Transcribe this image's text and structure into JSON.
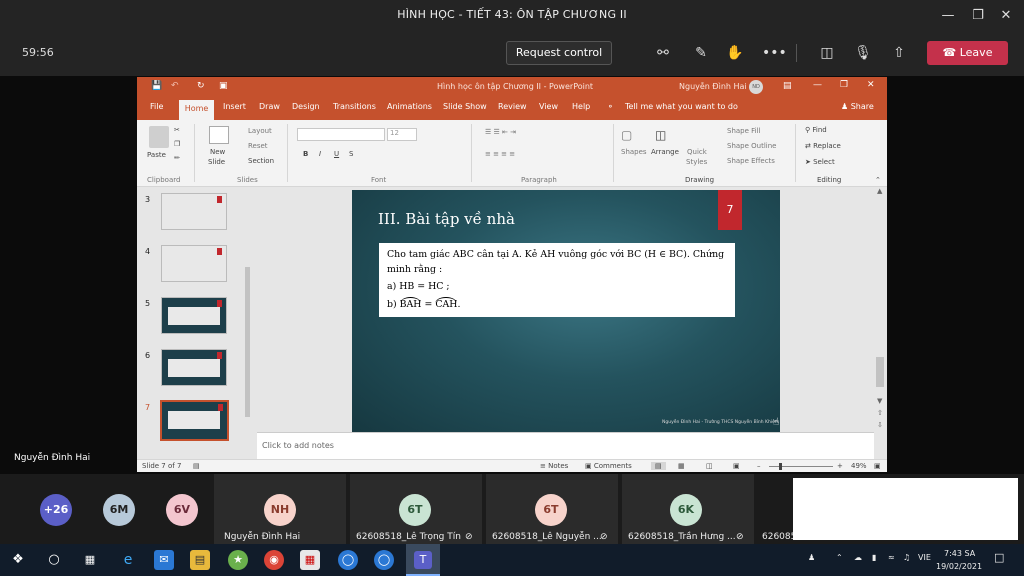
{
  "window": {
    "title": "HÌNH HỌC - TIẾT 43: ÔN TẬP CHƯƠNG II"
  },
  "meeting": {
    "timer": "59:56",
    "request_control": "Request control",
    "leave": "Leave",
    "icons": [
      "people-icon",
      "chat-icon",
      "raise-hand-icon",
      "more-icon",
      "camera-off-icon",
      "mic-off-icon",
      "share-tray-icon"
    ]
  },
  "ppt": {
    "title": "Hình học ôn tập Chương II  -  PowerPoint",
    "user": "Nguyễn Đình Hai",
    "user_initials": "ND",
    "tabs": [
      "File",
      "Home",
      "Insert",
      "Draw",
      "Design",
      "Transitions",
      "Animations",
      "Slide Show",
      "Review",
      "View",
      "Help"
    ],
    "tell_me": "Tell me what you want to do",
    "share": "Share",
    "ribbon": {
      "paste": "Paste",
      "clipboard": "Clipboard",
      "new_slide": "New",
      "new_slide2": "Slide",
      "layout": "Layout",
      "reset": "Reset",
      "section": "Section",
      "slides": "Slides",
      "font_size": "12",
      "font": "Font",
      "paragraph": "Paragraph",
      "shapes": "Shapes",
      "arrange": "Arrange",
      "quick": "Quick",
      "styles": "Styles",
      "shape_fill": "Shape Fill",
      "shape_outline": "Shape Outline",
      "shape_effects": "Shape Effects",
      "drawing": "Drawing",
      "find": "Find",
      "replace": "Replace",
      "select": "Select",
      "editing": "Editing"
    },
    "thumbs": [
      "3",
      "4",
      "5",
      "6",
      "7"
    ],
    "slide": {
      "title": "III. Bài tập về nhà",
      "number": "7",
      "line1": "Cho tam giác ABC cân tại A. Kẻ AH vuông góc với BC (H ∈ BC). Chứng minh rằng :",
      "line2": "a) HB = HC ;",
      "line3_prefix": "b) ",
      "arc1": "BAH",
      "eq": " = ",
      "arc2": "CAH",
      "end": ".",
      "footer": "Nguyễn Đình Hai - Trường THCS Nguyễn Bỉnh Khiêm"
    },
    "notes_placeholder": "Click to add notes",
    "status": {
      "slide": "Slide 7 of 7",
      "notes": "Notes",
      "comments": "Comments",
      "zoom": "49%"
    }
  },
  "presenter_label": "Nguyễn Đình Hai",
  "participants": [
    {
      "initials": "+26",
      "color": "#5b5fc7",
      "name": ""
    },
    {
      "initials": "6M",
      "color": "#b7c9d9",
      "name": ""
    },
    {
      "initials": "6V",
      "color": "#f3c6cf",
      "name": ""
    },
    {
      "initials": "NH",
      "color": "#f7d3cb",
      "name": "Nguyễn Đình Hai"
    },
    {
      "initials": "6T",
      "color": "#c9e4d3",
      "name": "62608518_Lê Trọng Tín"
    },
    {
      "initials": "6T",
      "color": "#f7d3cb",
      "name": "62608518_Lê Nguyễn ..."
    },
    {
      "initials": "6K",
      "color": "#c9e4d3",
      "name": "62608518_Trần Hưng ..."
    },
    {
      "initials": "",
      "color": "",
      "name": "626085..."
    }
  ],
  "taskbar": {
    "lang": "VIE",
    "time": "7:43 SA",
    "date": "19/02/2021"
  }
}
